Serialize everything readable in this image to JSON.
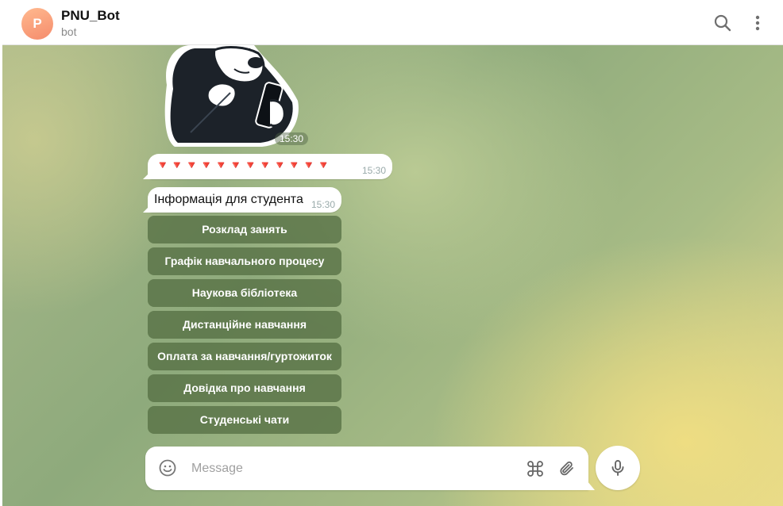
{
  "header": {
    "avatar_letter": "P",
    "bot_name": "PNU_Bot",
    "status": "bot",
    "icons": [
      "search-icon",
      "more-vertical-icon"
    ]
  },
  "messages": {
    "sticker_time": "15:30",
    "arrows_text": "🔻🔻🔻🔻🔻🔻🔻🔻🔻🔻🔻🔻",
    "arrows_time": "15:30",
    "info_text": "Інформація для студента",
    "info_time": "15:30"
  },
  "keyboard": [
    "Розклад занять",
    "Графік навчального процесу",
    "Наукова бібліотека",
    "Дистанційне навчання",
    "Оплата за навчання/гуртожиток",
    "Довідка про навчання",
    "Студенські чати"
  ],
  "composer": {
    "placeholder": "Message",
    "icons": [
      "emoji-icon",
      "command-icon",
      "paperclip-icon",
      "microphone-icon"
    ]
  },
  "colors": {
    "avatar": "#f58c6c",
    "keyboard_button": "#567044",
    "arrow_red": "#e02020"
  }
}
